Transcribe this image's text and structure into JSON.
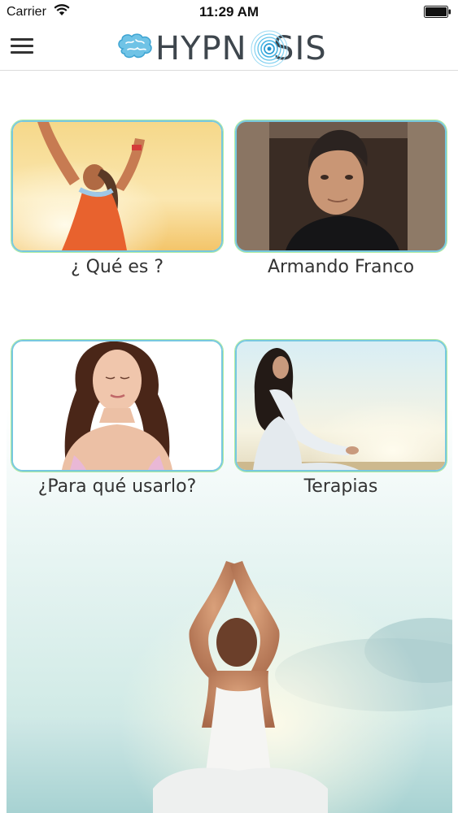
{
  "status_bar": {
    "carrier": "Carrier",
    "time": "11:29 AM",
    "icons": [
      "wifi-icon",
      "battery-icon"
    ]
  },
  "nav_bar": {
    "menu_icon": "hamburger-menu-icon",
    "logo_text_before": "HYPN",
    "logo_text_after": "SIS",
    "logo_icon": "brain-icon",
    "accent_color": "#4fb8e0"
  },
  "tiles": [
    {
      "label": "¿ Qué es ?",
      "image": "woman-raising-arms-sunset"
    },
    {
      "label": "Armando Franco",
      "image": "portrait-man-dark-shirt"
    },
    {
      "label": "¿Para qué usarlo?",
      "image": "woman-eyes-closed-portrait"
    },
    {
      "label": "Terapias",
      "image": "woman-meditating-beach"
    }
  ],
  "colors": {
    "tile_border_blue": "#77c8e0",
    "tile_border_green": "#7fd255",
    "text": "#333333"
  }
}
